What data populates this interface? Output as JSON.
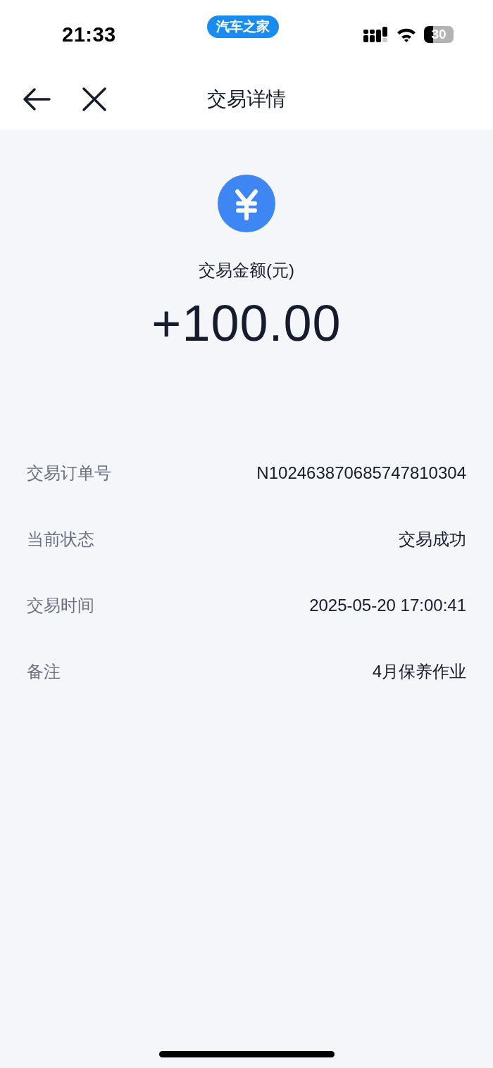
{
  "status_bar": {
    "time": "21:33",
    "app_badge": "汽车之家",
    "battery": "30"
  },
  "nav": {
    "title": "交易详情"
  },
  "amount": {
    "label": "交易金额(元)",
    "value": "+100.00"
  },
  "details": [
    {
      "label": "交易订单号",
      "value": "N102463870685747810304"
    },
    {
      "label": "当前状态",
      "value": "交易成功"
    },
    {
      "label": "交易时间",
      "value": "2025-05-20 17:00:41"
    },
    {
      "label": "备注",
      "value": "4月保养作业"
    }
  ]
}
